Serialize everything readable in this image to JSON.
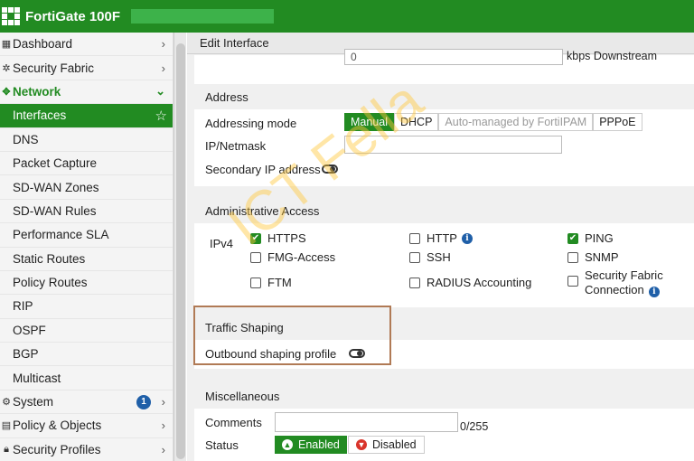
{
  "topbar": {
    "device_name": "FortiGate 100F"
  },
  "sidebar": {
    "items": [
      {
        "label": "Dashboard",
        "icon": "dashboard-icon"
      },
      {
        "label": "Security Fabric",
        "icon": "security-fabric-icon"
      },
      {
        "label": "Network",
        "icon": "network-icon"
      },
      {
        "label": "Interfaces"
      },
      {
        "label": "DNS"
      },
      {
        "label": "Packet Capture"
      },
      {
        "label": "SD-WAN Zones"
      },
      {
        "label": "SD-WAN Rules"
      },
      {
        "label": "Performance SLA"
      },
      {
        "label": "Static Routes"
      },
      {
        "label": "Policy Routes"
      },
      {
        "label": "RIP"
      },
      {
        "label": "OSPF"
      },
      {
        "label": "BGP"
      },
      {
        "label": "Multicast"
      },
      {
        "label": "System",
        "icon": "gear-icon",
        "badge": "1"
      },
      {
        "label": "Policy & Objects",
        "icon": "policy-icon"
      },
      {
        "label": "Security Profiles",
        "icon": "lock-icon"
      }
    ]
  },
  "main": {
    "header_title": "Edit Interface",
    "bandwidth": {
      "value": "0",
      "unit_label": "kbps Downstream"
    },
    "address": {
      "title": "Address",
      "addressing_mode_label": "Addressing mode",
      "modes": [
        "Manual",
        "DHCP",
        "Auto-managed by FortiIPAM",
        "PPPoE"
      ],
      "selected_mode": "Manual",
      "ip_netmask_label": "IP/Netmask",
      "ip_netmask_value": "",
      "secondary_ip_label": "Secondary IP address"
    },
    "admin_access": {
      "title": "Administrative Access",
      "ipv4_label": "IPv4",
      "options": [
        {
          "label": "HTTPS",
          "checked": true
        },
        {
          "label": "HTTP",
          "checked": false
        },
        {
          "label": "PING",
          "checked": true
        },
        {
          "label": "FMG-Access",
          "checked": false
        },
        {
          "label": "SSH",
          "checked": false
        },
        {
          "label": "SNMP",
          "checked": false
        },
        {
          "label": "FTM",
          "checked": false
        },
        {
          "label": "RADIUS Accounting",
          "checked": false
        },
        {
          "label": "Security Fabric",
          "label2": "Connection",
          "checked": false
        }
      ]
    },
    "traffic_shaping": {
      "title": "Traffic Shaping",
      "outbound_label": "Outbound shaping profile"
    },
    "misc": {
      "title": "Miscellaneous",
      "comments_label": "Comments",
      "comments_counter": "0/255",
      "status_label": "Status",
      "enabled_label": "Enabled",
      "disabled_label": "Disabled"
    }
  },
  "watermark": "ICT Fella",
  "colors": {
    "brand_green": "#228b22",
    "highlight_border": "#b07a55",
    "info_blue": "#1f5fa8"
  }
}
